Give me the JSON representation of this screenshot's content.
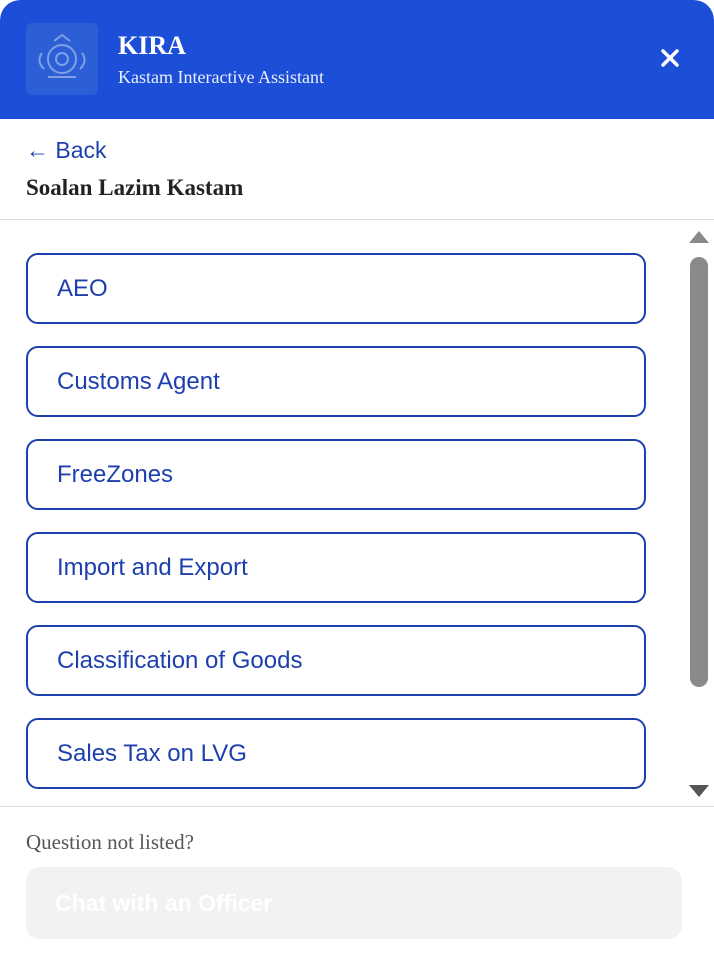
{
  "header": {
    "title": "KIRA",
    "subtitle": "Kastam Interactive Assistant",
    "logo_icon": "customs-crest-icon",
    "close_icon": "close-icon",
    "bg_color": "#1d4ed8"
  },
  "nav": {
    "back_label": "← Back",
    "section_title": "Soalan Lazim Kastam"
  },
  "topics": [
    {
      "label": "AEO"
    },
    {
      "label": "Customs Agent"
    },
    {
      "label": "FreeZones"
    },
    {
      "label": "Import and Export"
    },
    {
      "label": "Classification of Goods"
    },
    {
      "label": "Sales Tax on LVG"
    }
  ],
  "footer": {
    "prompt": "Question not listed?",
    "chat_button_label": "Chat with an Officer"
  },
  "colors": {
    "accent": "#1e40af",
    "divider": "#dcdcdc"
  }
}
